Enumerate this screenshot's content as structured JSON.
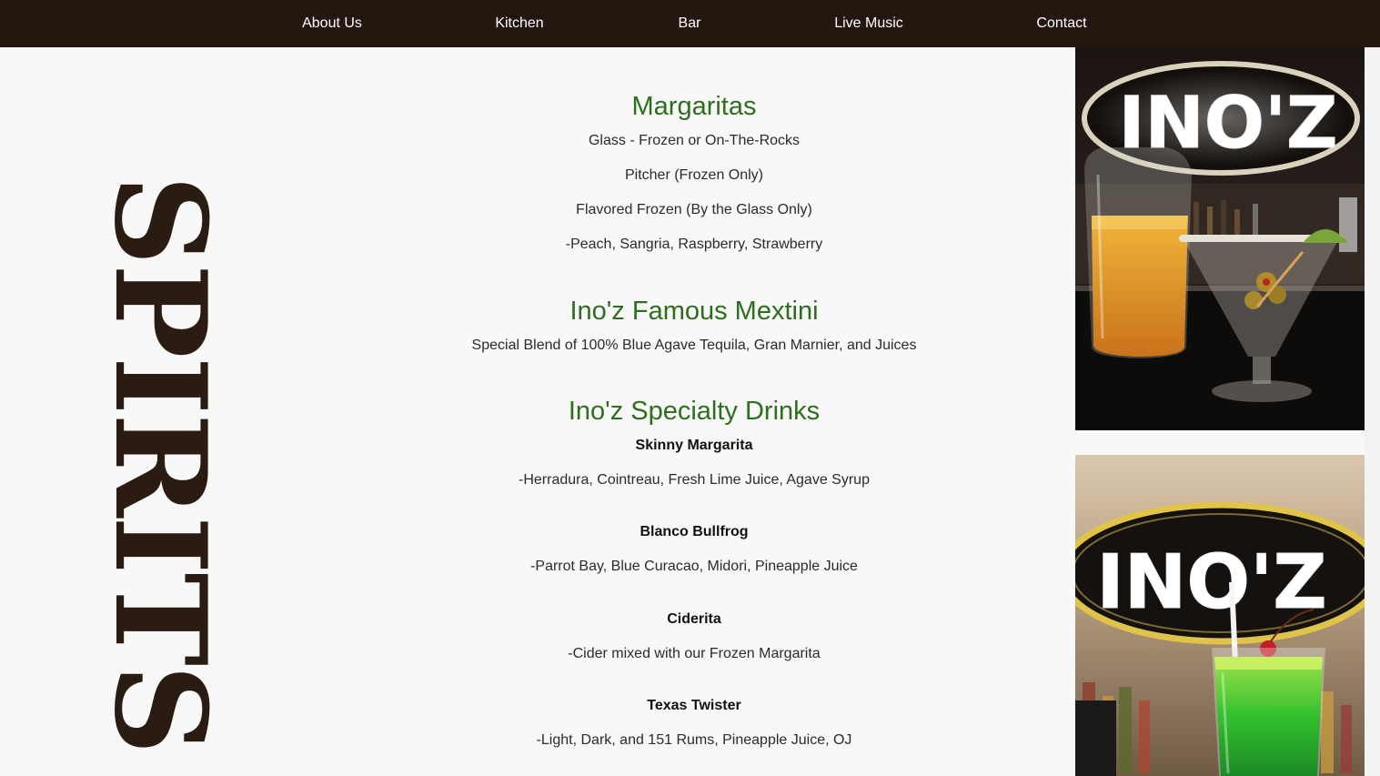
{
  "nav": {
    "items": [
      {
        "label": "About Us"
      },
      {
        "label": "Kitchen"
      },
      {
        "label": "Bar"
      },
      {
        "label": "Live Music"
      },
      {
        "label": "Contact"
      }
    ]
  },
  "side_title": "SPIRITS",
  "margaritas": {
    "heading": "Margaritas",
    "lines": [
      "Glass - Frozen or On-The-Rocks",
      "Pitcher (Frozen Only)",
      "Flavored Frozen (By the Glass Only)",
      "-Peach, Sangria, Raspberry, Strawberry"
    ]
  },
  "mextini": {
    "heading": "Ino'z Famous Mextini",
    "description": "Special Blend of 100% Blue Agave Tequila, Gran Marnier, and Juices"
  },
  "specialty": {
    "heading": "Ino'z Specialty Drinks",
    "drinks": [
      {
        "name": "Skinny Margarita",
        "ingredients": "-Herradura, Cointreau, Fresh Lime Juice, Agave Syrup"
      },
      {
        "name": "Blanco Bullfrog",
        "ingredients": "-Parrot Bay, Blue Curacao, Midori, Pineapple Juice"
      },
      {
        "name": "Ciderita",
        "ingredients": "-Cider mixed with our Frozen Margarita"
      },
      {
        "name": "Texas Twister",
        "ingredients": "-Light, Dark, and 151 Rums, Pineapple Juice, OJ"
      }
    ]
  },
  "photos": {
    "sign_text": "INO'Z"
  },
  "colors": {
    "nav_bg": "#24170f",
    "heading_green": "#2e6f1f",
    "title_brown": "#2a1c12",
    "page_bg": "#f8f8f8"
  }
}
